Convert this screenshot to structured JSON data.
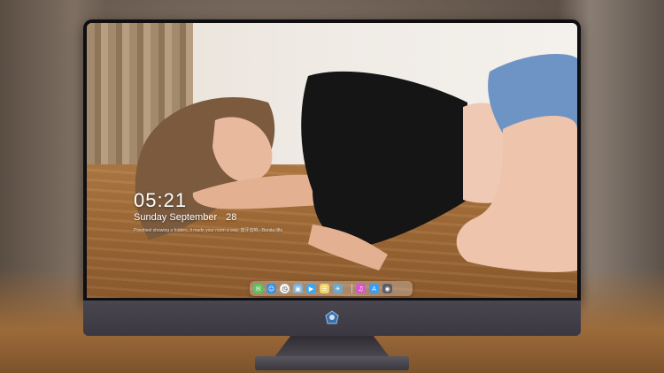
{
  "lock_screen": {
    "time": "05:21",
    "date_weekday_month": "Sunday September",
    "date_day": "28",
    "quote": "Pinwheel showing a folders, it made your room a way. 蓝牙音响 - Bonita lifts"
  },
  "dock": {
    "items": [
      {
        "name": "messages",
        "icon": "message-icon",
        "color": "#5fc25a"
      },
      {
        "name": "finder",
        "icon": "finder-icon",
        "color": "#3d8fe0"
      },
      {
        "name": "clock",
        "icon": "clock-icon",
        "color": "#f2f2f2"
      },
      {
        "name": "preview",
        "icon": "preview-icon",
        "color": "#7fb2d8"
      },
      {
        "name": "claquette",
        "icon": "clapperboard-icon",
        "color": "#42a5e8"
      },
      {
        "name": "notes",
        "icon": "notes-icon",
        "color": "#f3d35c"
      },
      {
        "name": "photos",
        "icon": "image-icon",
        "color": "#6ea8c9"
      },
      {
        "name": "itunes",
        "icon": "music-icon",
        "color": "#d857c8"
      },
      {
        "name": "app-store",
        "icon": "app-store-icon",
        "color": "#3c9cf2"
      },
      {
        "name": "camera",
        "icon": "camera-icon",
        "color": "#5c5c66"
      }
    ]
  }
}
